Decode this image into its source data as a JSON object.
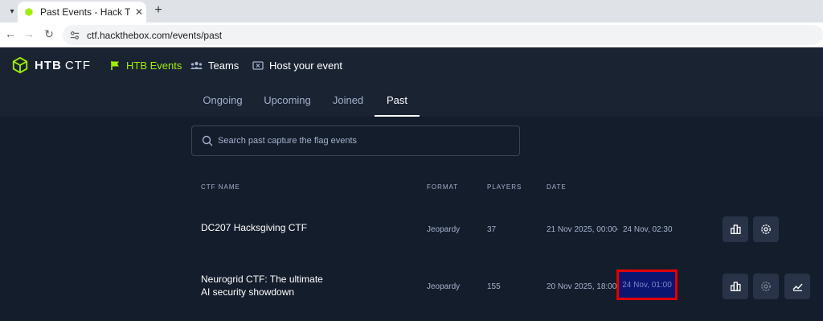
{
  "browser": {
    "tab_title": "Past Events - Hack The B",
    "new_tab_symbol": "+",
    "url": "ctf.hackthebox.com/events/past"
  },
  "header": {
    "logo_htb": "HTB",
    "logo_ctf": "CTF",
    "nav": [
      {
        "label": "HTB Events",
        "icon": "flag-icon",
        "active": true
      },
      {
        "label": "Teams",
        "icon": "users-icon",
        "active": false
      },
      {
        "label": "Host your event",
        "icon": "ticket-icon",
        "active": false
      }
    ],
    "tabs": [
      {
        "label": "Ongoing",
        "active": false
      },
      {
        "label": "Upcoming",
        "active": false
      },
      {
        "label": "Joined",
        "active": false
      },
      {
        "label": "Past",
        "active": true
      }
    ]
  },
  "search": {
    "placeholder": "Search past capture the flag events"
  },
  "table": {
    "columns": [
      "CTF NAME",
      "FORMAT",
      "PLAYERS",
      "DATE"
    ],
    "rows": [
      {
        "name_line1": "DC207 Hacksgiving CTF",
        "name_line2": "",
        "format": "Jeopardy",
        "players": "37",
        "date_start": "21 Nov 2025, 00:00",
        "date_sep": "-",
        "date_end": "24 Nov, 02:30",
        "actions": [
          "scoreboard-icon",
          "settings-icon"
        ]
      },
      {
        "name_line1": "Neurogrid CTF: The ultimate",
        "name_line2": "AI security showdown",
        "format": "Jeopardy",
        "players": "155",
        "date_start": "20 Nov 2025, 18:00",
        "date_sep": "",
        "date_end": "24 Nov, 01:00",
        "date_end_highlighted": true,
        "actions": [
          "scoreboard-icon",
          "settings-icon",
          "chart-icon"
        ]
      }
    ]
  },
  "colors": {
    "accent": "#9fef00",
    "background": "#141d2b",
    "header_bg": "#1a2332",
    "highlight_border": "#e10000"
  }
}
